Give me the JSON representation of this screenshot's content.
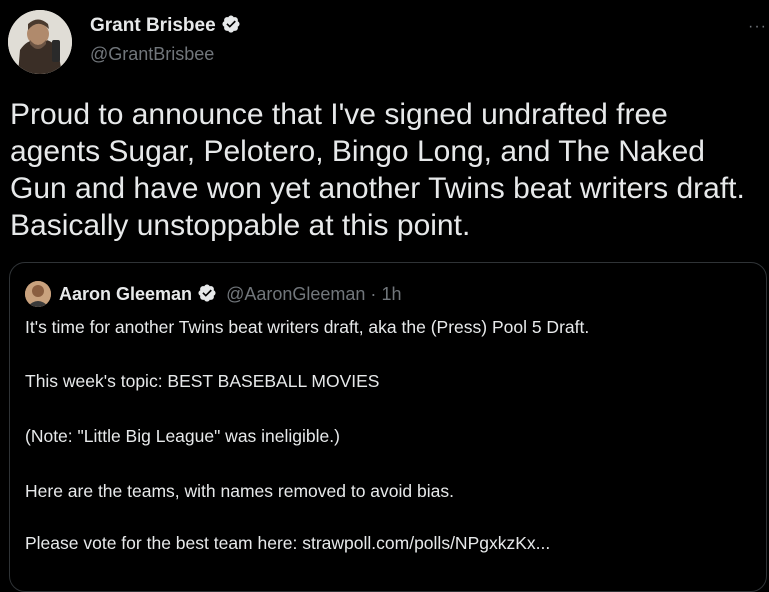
{
  "tweet": {
    "author_name": "Grant Brisbee",
    "author_handle": "@GrantBrisbee",
    "more_icon": "more-icon",
    "text": "Proud to announce that I've signed undrafted free agents Sugar, Pelotero, Bingo Long, and The Naked Gun and have won yet another Twins beat writers draft. Basically unstoppable at this point."
  },
  "quote": {
    "author_name": "Aaron Gleeman",
    "author_handle": "@AaronGleeman",
    "separator": "·",
    "time": "1h",
    "lines": [
      "It's time for another Twins beat writers draft, aka the (Press) Pool 5 Draft.",
      "This week's topic: BEST BASEBALL MOVIES",
      "(Note: \"Little Big League\" was ineligible.)",
      "Here are the teams, with names removed to avoid bias.",
      "Please vote for the best team here: strawpoll.com/polls/NPgxkzKx..."
    ]
  },
  "colors": {
    "background": "#000000",
    "text": "#e7e9ea",
    "secondary": "#71767b",
    "verified_badge": "#e7e9ea",
    "border": "#2f3336"
  }
}
